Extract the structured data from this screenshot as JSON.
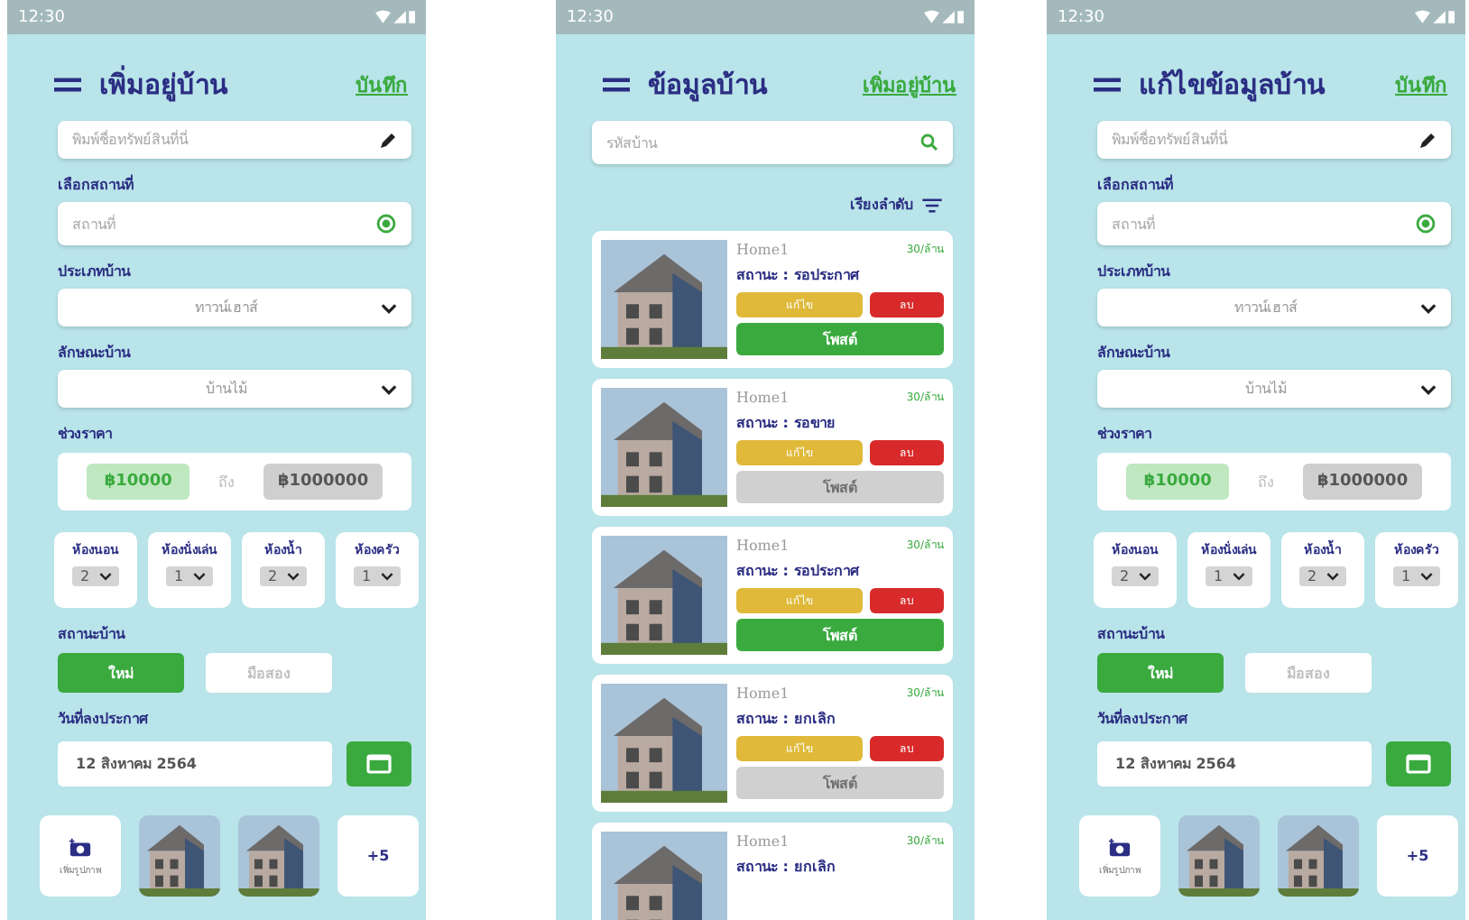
{
  "screens": [
    {
      "kind": "form",
      "status_time": "12:30",
      "title": "เพิ่มอยู่บ้าน",
      "action": "บันทึก",
      "name_field": {
        "placeholder": "พิมพ์ชื่อทรัพย์สินที่นี่"
      },
      "location": {
        "label": "เลือกสถานที่",
        "placeholder": "สถานที่"
      },
      "house_type": {
        "label": "ประเภทบ้าน",
        "value": "ทาวน์เฮาส์"
      },
      "house_style": {
        "label": "ลักษณะบ้าน",
        "value": "บ้านไม้"
      },
      "price": {
        "label": "ช่วงราคา",
        "min": "฿10000",
        "separator": "ถึง",
        "max": "฿1000000"
      },
      "rooms": [
        {
          "label": "ห้องนอน",
          "value": "2"
        },
        {
          "label": "ห้องนั่งเล่น",
          "value": "1"
        },
        {
          "label": "ห้องน้ำ",
          "value": "2"
        },
        {
          "label": "ห้องครัว",
          "value": "1"
        }
      ],
      "condition": {
        "label": "สถานะบ้าน",
        "options": [
          {
            "label": "ใหม่",
            "selected": true
          },
          {
            "label": "มือสอง",
            "selected": false
          }
        ]
      },
      "date": {
        "label": "วันที่ลงประกาศ",
        "value": "12 สิงหาคม 2564"
      },
      "photos": {
        "add_label": "เพิ่มรูปภาพ",
        "more": "+5"
      }
    },
    {
      "kind": "list",
      "status_time": "12:30",
      "title": "ข้อมูลบ้าน",
      "action": "เพิ่มอยู่บ้าน",
      "search": {
        "placeholder": "รหัสบ้าน"
      },
      "sort": "เรียงลำดับ",
      "items": [
        {
          "name": "Home1",
          "price": "30/ล้าน",
          "status": "สถานะ : รอประกาศ",
          "edit": "แก้ไข",
          "delete": "ลบ",
          "post": "โพสต์",
          "post_enabled": true
        },
        {
          "name": "Home1",
          "price": "30/ล้าน",
          "status": "สถานะ : รอขาย",
          "edit": "แก้ไข",
          "delete": "ลบ",
          "post": "โพสต์",
          "post_enabled": false
        },
        {
          "name": "Home1",
          "price": "30/ล้าน",
          "status": "สถานะ : รอประกาศ",
          "edit": "แก้ไข",
          "delete": "ลบ",
          "post": "โพสต์",
          "post_enabled": true
        },
        {
          "name": "Home1",
          "price": "30/ล้าน",
          "status": "สถานะ : ยกเลิก",
          "edit": "แก้ไข",
          "delete": "ลบ",
          "post": "โพสต์",
          "post_enabled": false
        },
        {
          "name": "Home1",
          "price": "30/ล้าน",
          "status": "สถานะ : ยกเลิก"
        }
      ]
    },
    {
      "kind": "form",
      "status_time": "12:30",
      "title": "แก้ไขข้อมูลบ้าน",
      "action": "บันทึก",
      "name_field": {
        "placeholder": "พิมพ์ชื่อทรัพย์สินที่นี่"
      },
      "location": {
        "label": "เลือกสถานที่",
        "placeholder": "สถานที่"
      },
      "house_type": {
        "label": "ประเภทบ้าน",
        "value": "ทาวน์เฮาส์"
      },
      "house_style": {
        "label": "ลักษณะบ้าน",
        "value": "บ้านไม้"
      },
      "price": {
        "label": "ช่วงราคา",
        "min": "฿10000",
        "separator": "ถึง",
        "max": "฿1000000"
      },
      "rooms": [
        {
          "label": "ห้องนอน",
          "value": "2"
        },
        {
          "label": "ห้องนั่งเล่น",
          "value": "1"
        },
        {
          "label": "ห้องน้ำ",
          "value": "2"
        },
        {
          "label": "ห้องครัว",
          "value": "1"
        }
      ],
      "condition": {
        "label": "สถานะบ้าน",
        "options": [
          {
            "label": "ใหม่",
            "selected": true
          },
          {
            "label": "มือสอง",
            "selected": false
          }
        ]
      },
      "date": {
        "label": "วันที่ลงประกาศ",
        "value": "12 สิงหาคม 2564"
      },
      "photos": {
        "add_label": "เพิ่มรูปภาพ",
        "more": "+5"
      }
    }
  ]
}
